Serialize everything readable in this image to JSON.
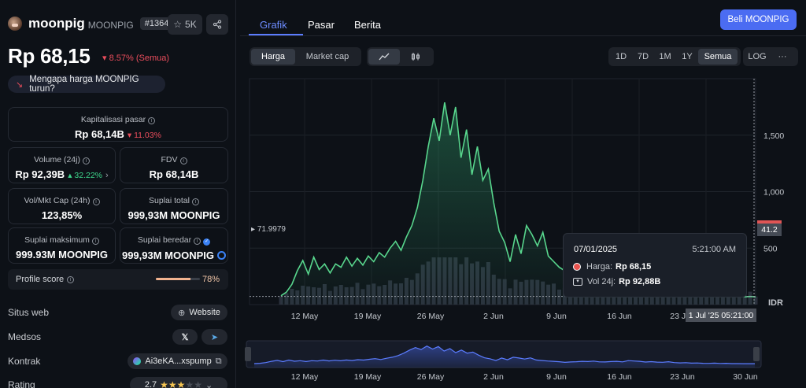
{
  "coin": {
    "name": "moonpig",
    "symbol": "MOONPIG",
    "rank": "#1364",
    "watchlist_count": "5K",
    "price": "Rp 68,15",
    "price_change": "8.57% (Semua)",
    "why_text": "Mengapa harga MOONPIG turun?"
  },
  "stats": {
    "market_cap": {
      "label": "Kapitalisasi pasar",
      "value": "Rp 68,14B",
      "change": "11.03%"
    },
    "volume": {
      "label": "Volume (24j)",
      "value": "Rp 92,39B",
      "change": "32.22%"
    },
    "fdv": {
      "label": "FDV",
      "value": "Rp 68,14B"
    },
    "vol_mkt_cap": {
      "label": "Vol/Mkt Cap (24h)",
      "value": "123,85%"
    },
    "total_supply": {
      "label": "Suplai total",
      "value": "999,93M MOONPIG"
    },
    "max_supply": {
      "label": "Suplai maksimum",
      "value": "999.93M MOONPIG"
    },
    "circulating_supply": {
      "label": "Suplai beredar",
      "value": "999,93M MOONPIG"
    }
  },
  "profile": {
    "label": "Profile score",
    "value": "78%",
    "fraction": 0.78
  },
  "links": {
    "website_label": "Situs web",
    "website_btn": "Website",
    "socials_label": "Medsos",
    "contract_label": "Kontrak",
    "contract_value": "Ai3eKA...xspump",
    "rating_label": "Rating",
    "rating_value": "2.7",
    "rating_stars": 2.7
  },
  "tabs": [
    "Grafik",
    "Pasar",
    "Berita"
  ],
  "buy_label": "Beli MOONPIG",
  "chart_controls": {
    "metric": [
      "Harga",
      "Market cap"
    ],
    "ranges": [
      "1D",
      "7D",
      "1M",
      "1Y",
      "Semua"
    ],
    "log": "LOG",
    "more": "···"
  },
  "chart_data": {
    "type": "line",
    "title": "",
    "xlabel": "",
    "ylabel": "IDR",
    "x_ticks": [
      "12 May",
      "19 May",
      "26 May",
      "2 Jun",
      "9 Jun",
      "16 Jun",
      "23 Jun"
    ],
    "y_ticks": [
      "500",
      "1,000",
      "1,500"
    ],
    "navigator_ticks": [
      "12 May",
      "19 May",
      "26 May",
      "2 Jun",
      "9 Jun",
      "16 Jun",
      "23 Jun",
      "30 Jun"
    ],
    "ylim": [
      0,
      2000
    ],
    "series": [
      {
        "values": [
          78,
          110,
          180,
          300,
          390,
          270,
          420,
          310,
          360,
          280,
          360,
          330,
          420,
          340,
          410,
          350,
          430,
          380,
          460,
          420,
          500,
          560,
          480,
          600,
          700,
          860,
          1100,
          1400,
          1650,
          1450,
          1790,
          1500,
          1750,
          1300,
          1550,
          1150,
          1400,
          1100,
          1200,
          900,
          650,
          550,
          380,
          620,
          450,
          700,
          620,
          520,
          640,
          430,
          380,
          330,
          300,
          260,
          200,
          240,
          260,
          300,
          280,
          320,
          250,
          240,
          280,
          300,
          250,
          370,
          330,
          300,
          230,
          270,
          220,
          210,
          260,
          180,
          150,
          170,
          120,
          140,
          110,
          100,
          120,
          90,
          105,
          80,
          75,
          68,
          72,
          68
        ]
      }
    ],
    "reference_value": "71.9979",
    "last_price_label": "41.2",
    "crosshair_time": "1 Jul '25 05:21:00",
    "tooltip": {
      "date": "07/01/2025",
      "time": "5:21:00 AM",
      "price_label": "Harga:",
      "price_value": "Rp 68,15",
      "vol_label": "Vol 24j:",
      "vol_value": "Rp 92,88B"
    }
  }
}
